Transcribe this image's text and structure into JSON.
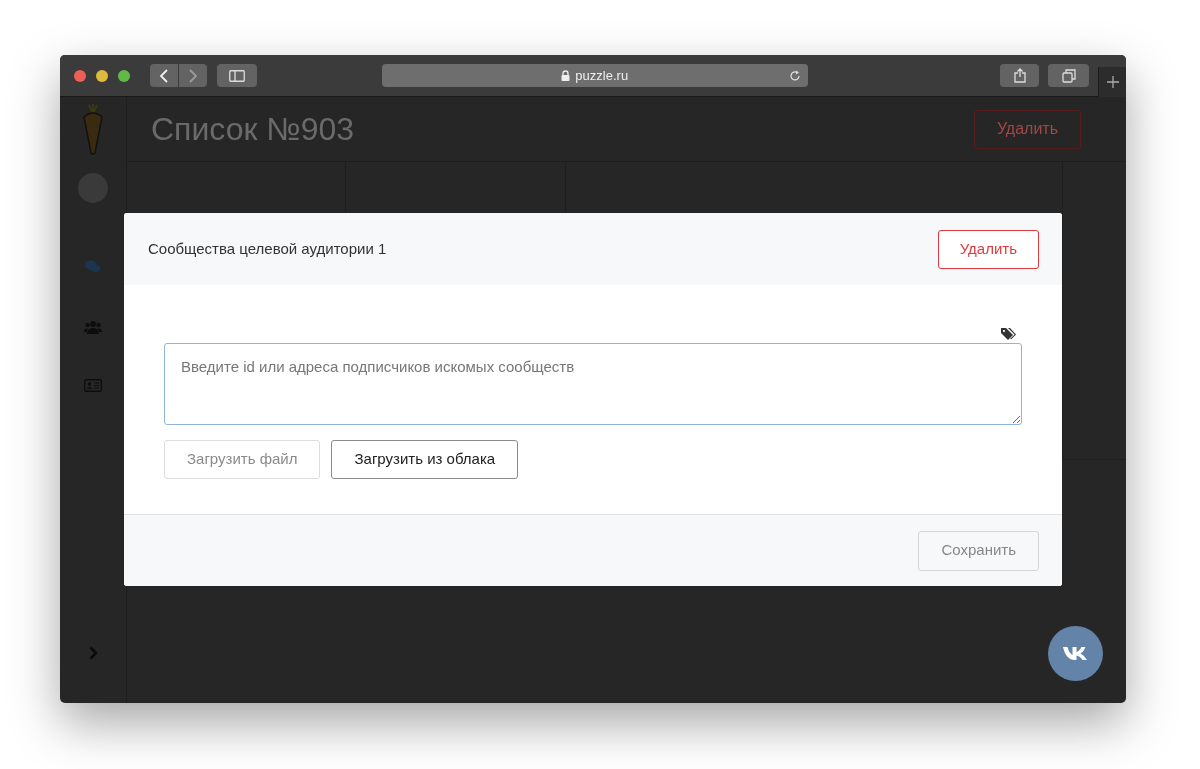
{
  "browser": {
    "url": "puzzle.ru",
    "back_enabled": true,
    "forward_enabled": false
  },
  "page": {
    "title": "Список №903",
    "delete_button": "Удалить"
  },
  "modal": {
    "title": "Сообщества целевой аудитории 1",
    "delete_button": "Удалить",
    "textarea": {
      "placeholder": "Введите id или адреса подписчиков искомых сообществ"
    },
    "actions": [
      {
        "label": "Загрузить файл",
        "disabled": true
      },
      {
        "label": "Загрузить из облака",
        "disabled": false
      }
    ],
    "save_button": {
      "label": "Сохранить",
      "disabled": true
    }
  }
}
